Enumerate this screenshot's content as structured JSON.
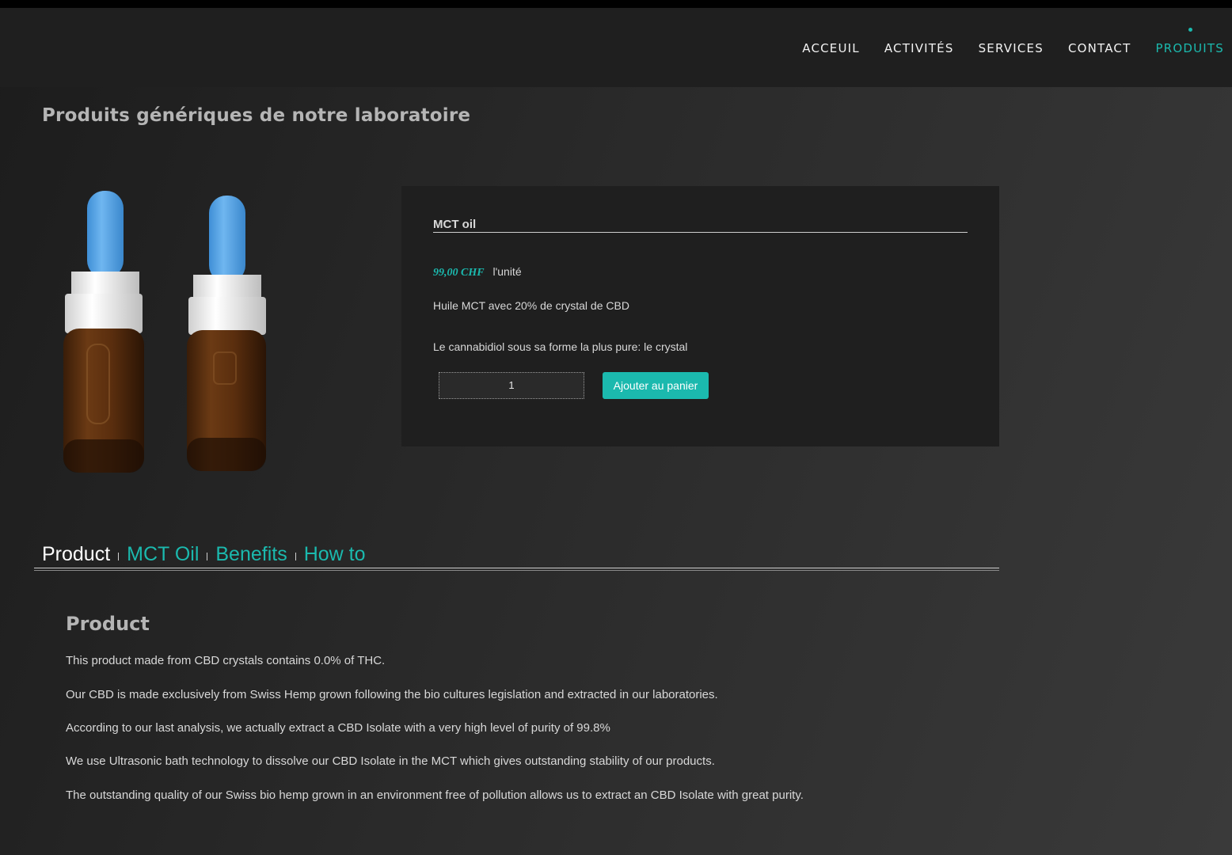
{
  "nav": {
    "items": [
      "ACCEUIL",
      "ACTIVITÉS",
      "SERVICES",
      "CONTACT",
      "PRODUITS"
    ],
    "active": "PRODUITS"
  },
  "page_title": "Produits génériques de notre laboratoire",
  "product": {
    "image_icon": "cbd-dropper-bottles-image",
    "title": "MCT oil",
    "price": "99,00 CHF",
    "unit": "l'unité",
    "description1": "Huile MCT avec 20% de crystal de CBD",
    "description2": "Le cannabidiol sous sa forme la plus pure: le crystal",
    "quantity": "1",
    "add_to_cart_label": "Ajouter au panier"
  },
  "tabs": {
    "items": [
      "Product",
      "MCT Oil",
      "Benefits",
      "How to"
    ],
    "active": "Product"
  },
  "section": {
    "title": "Product",
    "paragraphs": [
      "This product made from CBD crystals contains 0.0% of THC.",
      "Our CBD is made exclusively from Swiss Hemp grown following the bio cultures legislation and extracted in our laboratories.",
      "According to our last analysis, we actually extract a CBD Isolate with a very high level of purity of 99.8%",
      "We use Ultrasonic bath technology to dissolve our CBD Isolate in the MCT which gives outstanding stability of our products.",
      "The outstanding quality of our Swiss bio hemp grown in an environment free of pollution allows us to extract an CBD Isolate with great purity."
    ]
  },
  "colors": {
    "accent": "#1bb9ae",
    "header_bg": "#1f1f1f",
    "card_bg": "#1f1f1f"
  }
}
